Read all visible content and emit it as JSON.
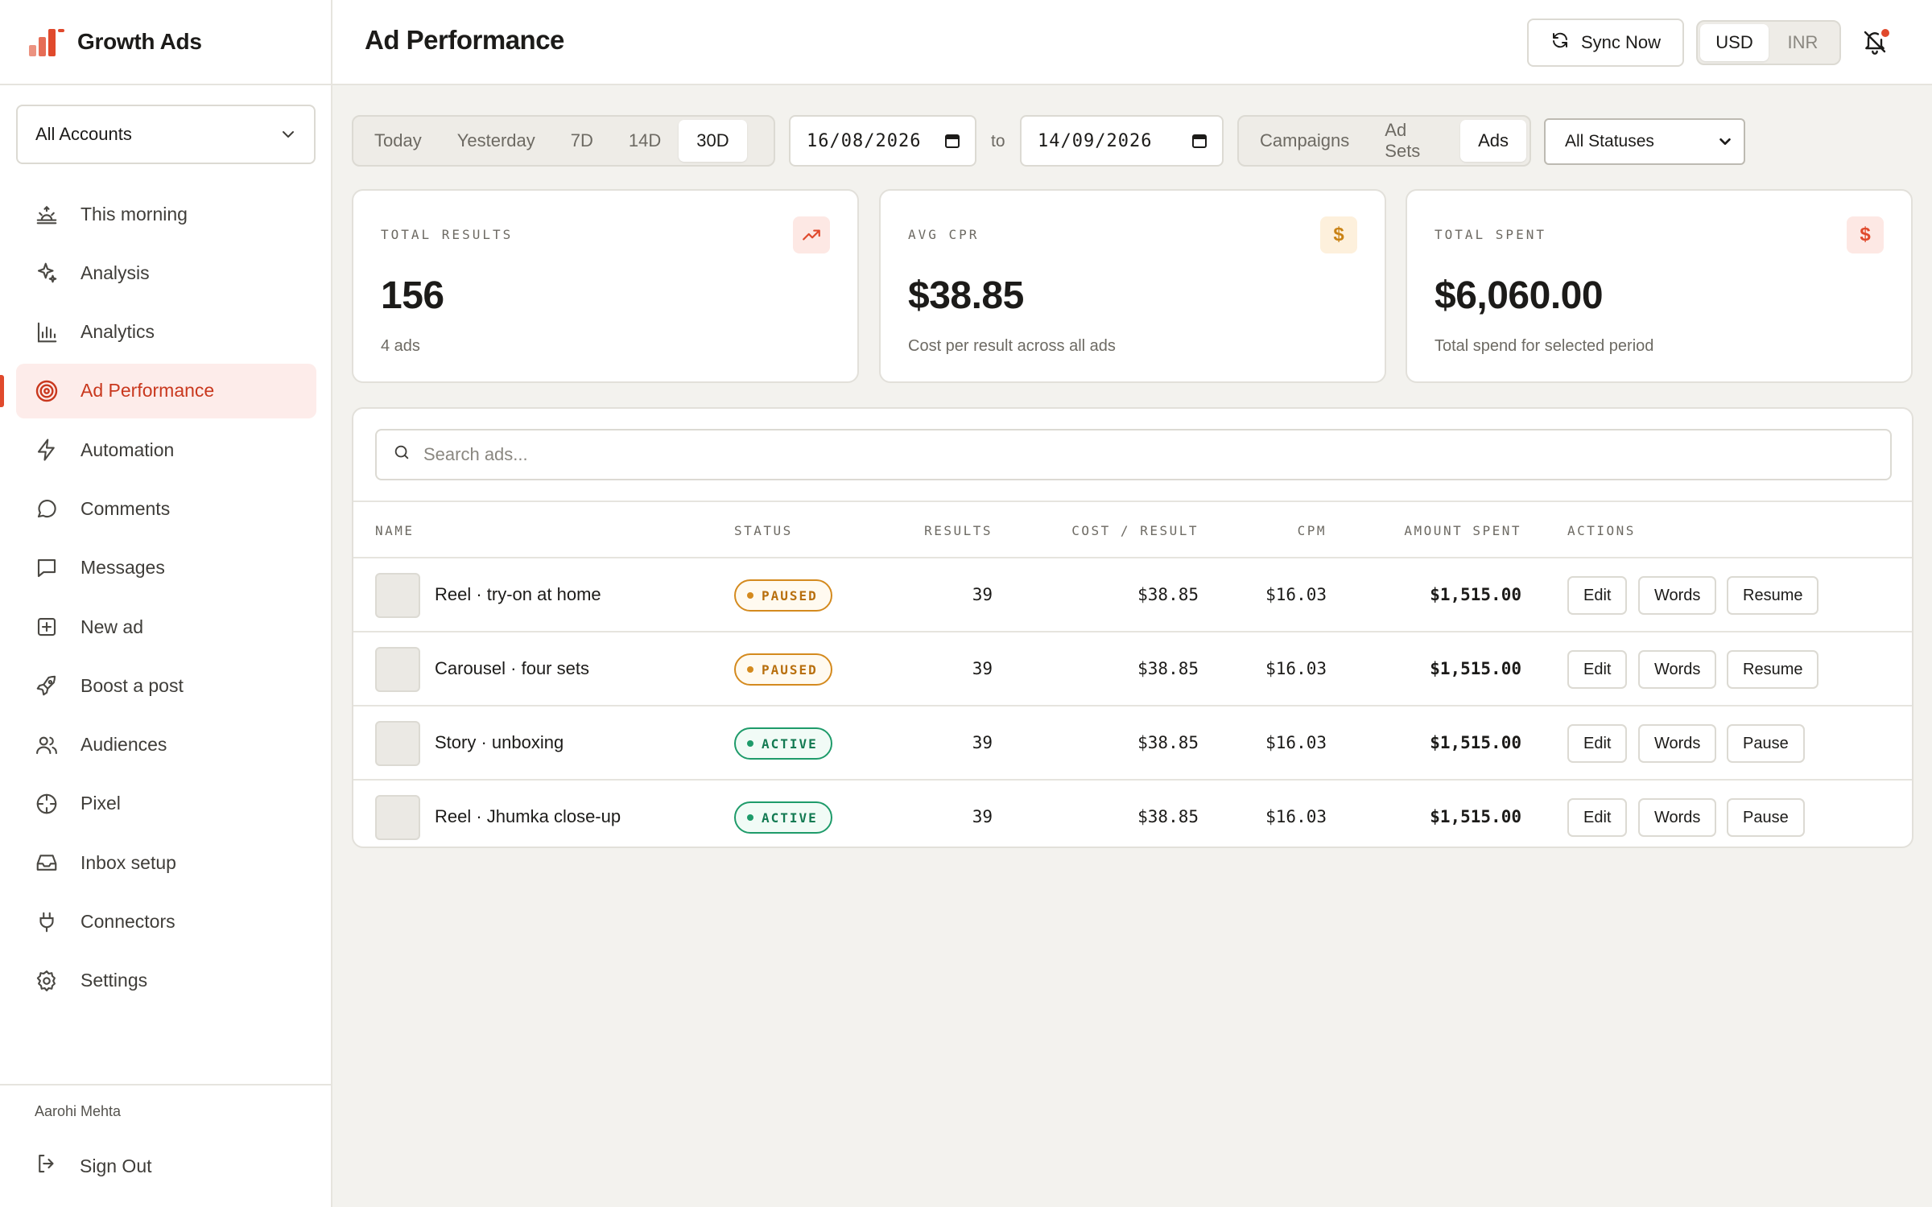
{
  "brand": {
    "name": "Growth Ads",
    "accent": "#e0492c"
  },
  "account_select": {
    "value": "All Accounts"
  },
  "sidebar": {
    "items": [
      {
        "label": "This morning",
        "icon": "sunrise-icon",
        "active": false
      },
      {
        "label": "Analysis",
        "icon": "sparkles-icon",
        "active": false
      },
      {
        "label": "Analytics",
        "icon": "bar-chart-icon",
        "active": false
      },
      {
        "label": "Ad Performance",
        "icon": "target-icon",
        "active": true
      },
      {
        "label": "Automation",
        "icon": "lightning-icon",
        "active": false
      },
      {
        "label": "Comments",
        "icon": "comment-icon",
        "active": false
      },
      {
        "label": "Messages",
        "icon": "message-square-icon",
        "active": false
      },
      {
        "label": "New ad",
        "icon": "plus-square-icon",
        "active": false
      },
      {
        "label": "Boost a post",
        "icon": "rocket-icon",
        "active": false
      },
      {
        "label": "Audiences",
        "icon": "users-icon",
        "active": false
      },
      {
        "label": "Pixel",
        "icon": "crosshair-icon",
        "active": false
      },
      {
        "label": "Inbox setup",
        "icon": "inbox-icon",
        "active": false
      },
      {
        "label": "Connectors",
        "icon": "plug-icon",
        "active": false
      },
      {
        "label": "Settings",
        "icon": "gear-icon",
        "active": false
      }
    ],
    "user_name": "Aarohi Mehta",
    "sign_out": "Sign Out"
  },
  "header": {
    "title": "Ad Performance",
    "sync_label": "Sync Now",
    "currency": {
      "options": [
        "USD",
        "INR"
      ],
      "selected": "USD"
    }
  },
  "filters": {
    "ranges": [
      "Today",
      "Yesterday",
      "7D",
      "14D",
      "30D"
    ],
    "selected_range": "30D",
    "date_from": "16/08/2026",
    "to_label": "to",
    "date_to": "14/09/2026",
    "levels": [
      "Campaigns",
      "Ad Sets",
      "Ads"
    ],
    "selected_level": "Ads",
    "status_value": "All Statuses"
  },
  "stats": [
    {
      "label": "TOTAL RESULTS",
      "value": "156",
      "sub": "4 ads",
      "icon": "trending-up-icon"
    },
    {
      "label": "AVG CPR",
      "value": "$38.85",
      "sub": "Cost per result across all ads",
      "icon": "dollar-icon"
    },
    {
      "label": "TOTAL SPENT",
      "value": "$6,060.00",
      "sub": "Total spend for selected period",
      "icon": "dollar-icon"
    }
  ],
  "table": {
    "search_placeholder": "Search ads...",
    "columns": [
      "NAME",
      "STATUS",
      "RESULTS",
      "COST / RESULT",
      "CPM",
      "AMOUNT SPENT",
      "ACTIONS"
    ],
    "rows": [
      {
        "name": "Reel · try-on at home",
        "status": "PAUSED",
        "results": "39",
        "cpr": "$38.85",
        "cpm": "$16.03",
        "spent": "$1,515.00",
        "actions": [
          "Edit",
          "Words",
          "Resume"
        ]
      },
      {
        "name": "Carousel · four sets",
        "status": "PAUSED",
        "results": "39",
        "cpr": "$38.85",
        "cpm": "$16.03",
        "spent": "$1,515.00",
        "actions": [
          "Edit",
          "Words",
          "Resume"
        ]
      },
      {
        "name": "Story · unboxing",
        "status": "ACTIVE",
        "results": "39",
        "cpr": "$38.85",
        "cpm": "$16.03",
        "spent": "$1,515.00",
        "actions": [
          "Edit",
          "Words",
          "Pause"
        ]
      },
      {
        "name": "Reel · Jhumka close-up",
        "status": "ACTIVE",
        "results": "39",
        "cpr": "$38.85",
        "cpm": "$16.03",
        "spent": "$1,515.00",
        "actions": [
          "Edit",
          "Words",
          "Pause"
        ]
      }
    ]
  }
}
